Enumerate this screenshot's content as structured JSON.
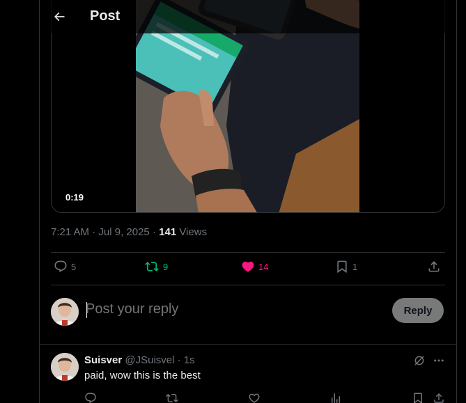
{
  "header": {
    "title": "Post"
  },
  "media": {
    "duration": "0:19"
  },
  "meta": {
    "time": "7:21 AM",
    "sep1": " · ",
    "date": "Jul 9, 2025",
    "sep2": " · ",
    "views_count": "141",
    "views_label": " Views"
  },
  "actions": {
    "replies": "5",
    "reposts": "9",
    "likes": "14",
    "bookmarks": "1"
  },
  "colors": {
    "repost": "#00ba7c",
    "like": "#f91880",
    "muted": "#71767b",
    "text": "#e7e9ea",
    "border": "#2f3336"
  },
  "compose": {
    "placeholder": "Post your reply",
    "button": "Reply"
  },
  "comment": {
    "name": "Suisver",
    "handle": "@JSuisvel",
    "sep": " · ",
    "time": "1s",
    "text": "paid, wow this is the best"
  }
}
